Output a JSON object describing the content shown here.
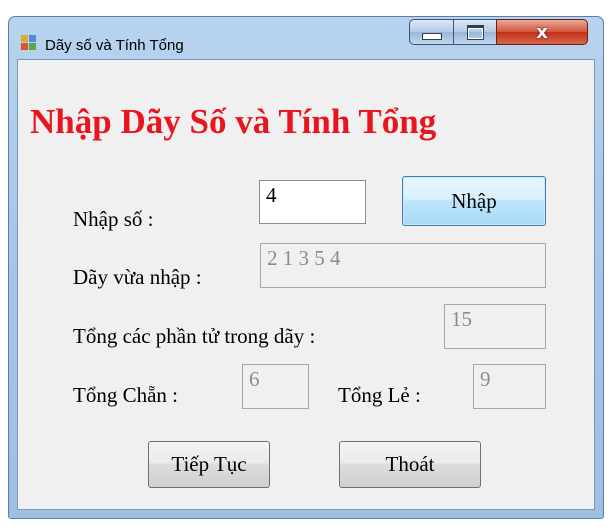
{
  "window": {
    "title": "Dãy số và Tính Tổng"
  },
  "controls": {
    "minimize_icon": "minimize-icon",
    "maximize_icon": "maximize-icon",
    "close_glyph": "x"
  },
  "form": {
    "heading": "Nhập Dãy Số và Tính Tổng",
    "input_label": "Nhập số :",
    "input_value": "4",
    "enter_button": "Nhập",
    "sequence_label": "Dãy vừa nhập :",
    "sequence_value": "2 1 3 5 4",
    "total_label": "Tổng các phần tử trong dãy :",
    "total_value": "15",
    "even_label": "Tổng Chẵn :",
    "even_value": "6",
    "odd_label": "Tổng Lẻ :",
    "odd_value": "9",
    "continue_button": "Tiếp Tục",
    "exit_button": "Thoát"
  },
  "colors": {
    "heading": "#e8141e",
    "title_bar": "#a9c7e7",
    "client": "#f0f0f0",
    "close_button": "#c0301a"
  }
}
